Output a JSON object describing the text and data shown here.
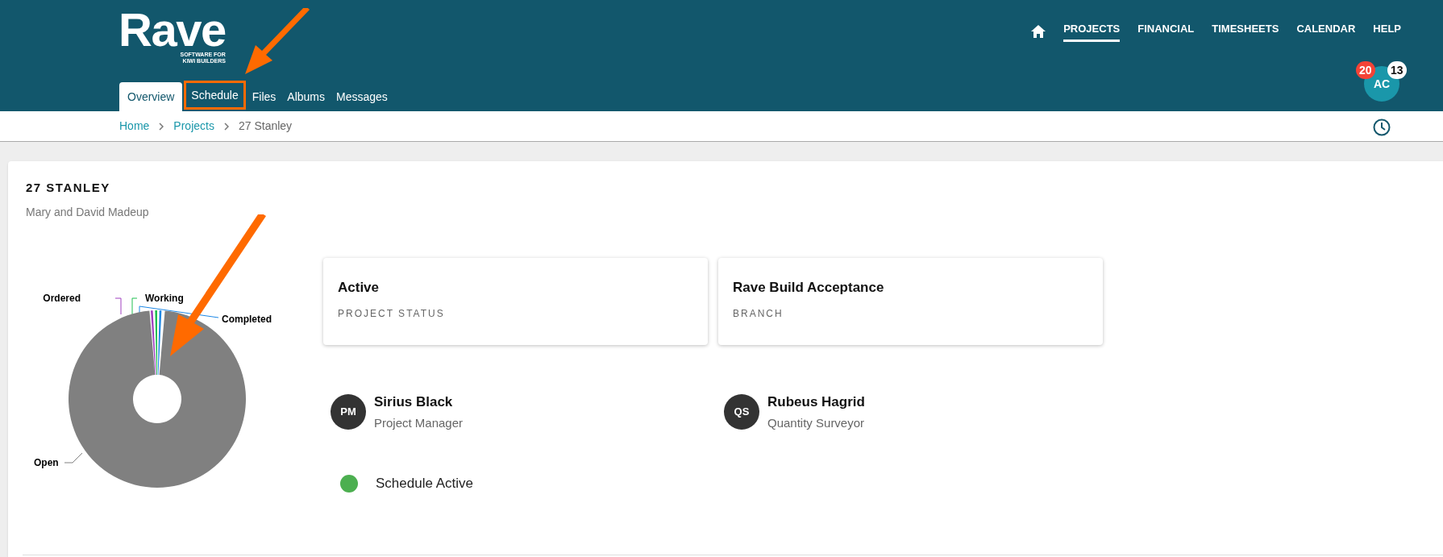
{
  "header": {
    "logo": {
      "name": "Rave",
      "tagline_lines": [
        "SOFTWARE FOR",
        "KIWI BUILDERS"
      ]
    },
    "nav": [
      {
        "label": "PROJECTS",
        "selected": true
      },
      {
        "label": "FINANCIAL",
        "selected": false
      },
      {
        "label": "TIMESHEETS",
        "selected": false
      },
      {
        "label": "CALENDAR",
        "selected": false
      },
      {
        "label": "HELP",
        "selected": false
      }
    ],
    "tabs": [
      {
        "label": "Overview",
        "selected": true,
        "highlighted": false
      },
      {
        "label": "Schedule",
        "selected": false,
        "highlighted": true
      },
      {
        "label": "Files",
        "selected": false,
        "highlighted": false
      },
      {
        "label": "Albums",
        "selected": false,
        "highlighted": false
      },
      {
        "label": "Messages",
        "selected": false,
        "highlighted": false
      }
    ],
    "user": {
      "initials": "AC",
      "badges": [
        {
          "count": "20",
          "color": "#f44336"
        },
        {
          "count": "13",
          "color": "#ffffff"
        }
      ]
    }
  },
  "breadcrumb": [
    {
      "label": "Home",
      "kind": "link"
    },
    {
      "label": "Projects",
      "kind": "link"
    },
    {
      "label": "27 Stanley",
      "kind": "current"
    }
  ],
  "project": {
    "title": "27 STANLEY",
    "client": "Mary and David Madeup",
    "chart_segments": [
      {
        "label": "Ordered",
        "color": "#a040c0"
      },
      {
        "label": "Working",
        "color": "#20c050"
      },
      {
        "label": "Completed",
        "color": "#1e88e5"
      },
      {
        "label": "Open",
        "color": "#808080"
      }
    ],
    "info_cards": [
      {
        "value": "Active",
        "label": "PROJECT STATUS"
      },
      {
        "value": "Rave Build Acceptance",
        "label": "BRANCH"
      }
    ],
    "people": [
      {
        "initials": "PM",
        "name": "Sirius Black",
        "role": "Project Manager"
      },
      {
        "initials": "QS",
        "name": "Rubeus Hagrid",
        "role": "Quantity Surveyor"
      }
    ],
    "schedule_status": {
      "label": "Schedule Active",
      "active": true
    }
  }
}
